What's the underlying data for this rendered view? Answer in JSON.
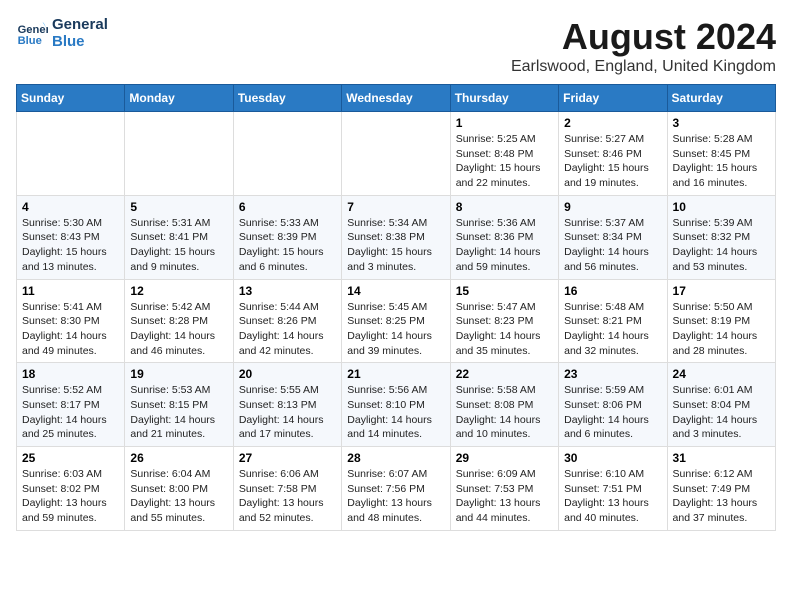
{
  "logo": {
    "line1": "General",
    "line2": "Blue"
  },
  "title": "August 2024",
  "subtitle": "Earlswood, England, United Kingdom",
  "days_of_week": [
    "Sunday",
    "Monday",
    "Tuesday",
    "Wednesday",
    "Thursday",
    "Friday",
    "Saturday"
  ],
  "weeks": [
    [
      {
        "num": "",
        "info": ""
      },
      {
        "num": "",
        "info": ""
      },
      {
        "num": "",
        "info": ""
      },
      {
        "num": "",
        "info": ""
      },
      {
        "num": "1",
        "info": "Sunrise: 5:25 AM\nSunset: 8:48 PM\nDaylight: 15 hours\nand 22 minutes."
      },
      {
        "num": "2",
        "info": "Sunrise: 5:27 AM\nSunset: 8:46 PM\nDaylight: 15 hours\nand 19 minutes."
      },
      {
        "num": "3",
        "info": "Sunrise: 5:28 AM\nSunset: 8:45 PM\nDaylight: 15 hours\nand 16 minutes."
      }
    ],
    [
      {
        "num": "4",
        "info": "Sunrise: 5:30 AM\nSunset: 8:43 PM\nDaylight: 15 hours\nand 13 minutes."
      },
      {
        "num": "5",
        "info": "Sunrise: 5:31 AM\nSunset: 8:41 PM\nDaylight: 15 hours\nand 9 minutes."
      },
      {
        "num": "6",
        "info": "Sunrise: 5:33 AM\nSunset: 8:39 PM\nDaylight: 15 hours\nand 6 minutes."
      },
      {
        "num": "7",
        "info": "Sunrise: 5:34 AM\nSunset: 8:38 PM\nDaylight: 15 hours\nand 3 minutes."
      },
      {
        "num": "8",
        "info": "Sunrise: 5:36 AM\nSunset: 8:36 PM\nDaylight: 14 hours\nand 59 minutes."
      },
      {
        "num": "9",
        "info": "Sunrise: 5:37 AM\nSunset: 8:34 PM\nDaylight: 14 hours\nand 56 minutes."
      },
      {
        "num": "10",
        "info": "Sunrise: 5:39 AM\nSunset: 8:32 PM\nDaylight: 14 hours\nand 53 minutes."
      }
    ],
    [
      {
        "num": "11",
        "info": "Sunrise: 5:41 AM\nSunset: 8:30 PM\nDaylight: 14 hours\nand 49 minutes."
      },
      {
        "num": "12",
        "info": "Sunrise: 5:42 AM\nSunset: 8:28 PM\nDaylight: 14 hours\nand 46 minutes."
      },
      {
        "num": "13",
        "info": "Sunrise: 5:44 AM\nSunset: 8:26 PM\nDaylight: 14 hours\nand 42 minutes."
      },
      {
        "num": "14",
        "info": "Sunrise: 5:45 AM\nSunset: 8:25 PM\nDaylight: 14 hours\nand 39 minutes."
      },
      {
        "num": "15",
        "info": "Sunrise: 5:47 AM\nSunset: 8:23 PM\nDaylight: 14 hours\nand 35 minutes."
      },
      {
        "num": "16",
        "info": "Sunrise: 5:48 AM\nSunset: 8:21 PM\nDaylight: 14 hours\nand 32 minutes."
      },
      {
        "num": "17",
        "info": "Sunrise: 5:50 AM\nSunset: 8:19 PM\nDaylight: 14 hours\nand 28 minutes."
      }
    ],
    [
      {
        "num": "18",
        "info": "Sunrise: 5:52 AM\nSunset: 8:17 PM\nDaylight: 14 hours\nand 25 minutes."
      },
      {
        "num": "19",
        "info": "Sunrise: 5:53 AM\nSunset: 8:15 PM\nDaylight: 14 hours\nand 21 minutes."
      },
      {
        "num": "20",
        "info": "Sunrise: 5:55 AM\nSunset: 8:13 PM\nDaylight: 14 hours\nand 17 minutes."
      },
      {
        "num": "21",
        "info": "Sunrise: 5:56 AM\nSunset: 8:10 PM\nDaylight: 14 hours\nand 14 minutes."
      },
      {
        "num": "22",
        "info": "Sunrise: 5:58 AM\nSunset: 8:08 PM\nDaylight: 14 hours\nand 10 minutes."
      },
      {
        "num": "23",
        "info": "Sunrise: 5:59 AM\nSunset: 8:06 PM\nDaylight: 14 hours\nand 6 minutes."
      },
      {
        "num": "24",
        "info": "Sunrise: 6:01 AM\nSunset: 8:04 PM\nDaylight: 14 hours\nand 3 minutes."
      }
    ],
    [
      {
        "num": "25",
        "info": "Sunrise: 6:03 AM\nSunset: 8:02 PM\nDaylight: 13 hours\nand 59 minutes."
      },
      {
        "num": "26",
        "info": "Sunrise: 6:04 AM\nSunset: 8:00 PM\nDaylight: 13 hours\nand 55 minutes."
      },
      {
        "num": "27",
        "info": "Sunrise: 6:06 AM\nSunset: 7:58 PM\nDaylight: 13 hours\nand 52 minutes."
      },
      {
        "num": "28",
        "info": "Sunrise: 6:07 AM\nSunset: 7:56 PM\nDaylight: 13 hours\nand 48 minutes."
      },
      {
        "num": "29",
        "info": "Sunrise: 6:09 AM\nSunset: 7:53 PM\nDaylight: 13 hours\nand 44 minutes."
      },
      {
        "num": "30",
        "info": "Sunrise: 6:10 AM\nSunset: 7:51 PM\nDaylight: 13 hours\nand 40 minutes."
      },
      {
        "num": "31",
        "info": "Sunrise: 6:12 AM\nSunset: 7:49 PM\nDaylight: 13 hours\nand 37 minutes."
      }
    ]
  ]
}
